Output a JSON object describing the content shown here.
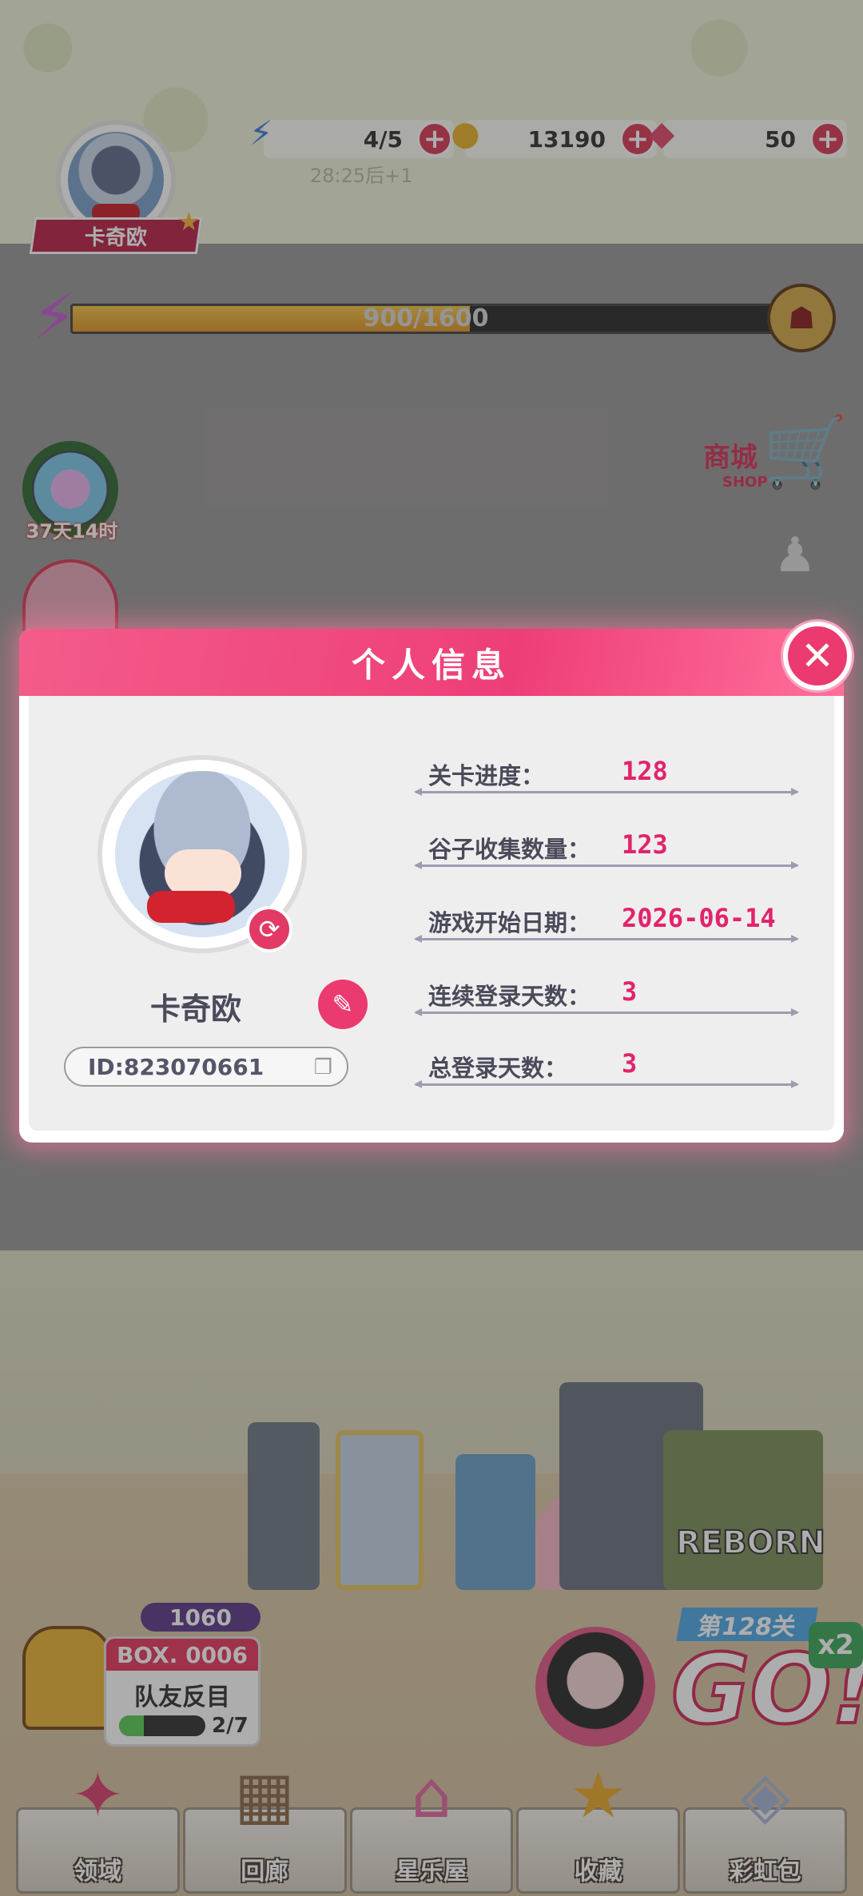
{
  "hud": {
    "player_name": "卡奇欧",
    "energy": "4/5",
    "energy_timer": "28:25后+1",
    "coins": "13190",
    "gems": "50",
    "xp_text": "900/1600",
    "xp_progress": 0.5625,
    "shop_label": "商城",
    "shop_sub": "SHOP",
    "event_timer": "37天14时"
  },
  "modal": {
    "title": "个人信息",
    "close_icon": "close-icon",
    "profile": {
      "name": "卡奇欧",
      "id": "ID:823070661"
    },
    "stats": [
      {
        "label": "关卡进度：",
        "value": "128"
      },
      {
        "label": "谷子收集数量：",
        "value": "123"
      },
      {
        "label": "游戏开始日期：",
        "value": "2026-06-14"
      },
      {
        "label": "连续登录天数：",
        "value": "3"
      },
      {
        "label": "总登录天数：",
        "value": "3"
      }
    ]
  },
  "scene": {
    "reborn_text": "REBORN",
    "coin_count": "1060",
    "box_label": "BOX. 0006",
    "box_title": "队友反目",
    "box_progress_text": "2/7",
    "box_progress": 0.2857,
    "level_badge": "第128关",
    "go_text": "GO!",
    "multiplier": "x2"
  },
  "nav": [
    {
      "label": "领域",
      "icon": "domain-icon"
    },
    {
      "label": "回廊",
      "icon": "corridor-icon"
    },
    {
      "label": "星乐屋",
      "icon": "house-icon"
    },
    {
      "label": "收藏",
      "icon": "star-icon"
    },
    {
      "label": "彩虹包",
      "icon": "rainbow-pack-icon"
    }
  ],
  "colors": {
    "accent": "#ea3a70",
    "stat_value": "#e2236c",
    "header": "#ee3e77"
  }
}
